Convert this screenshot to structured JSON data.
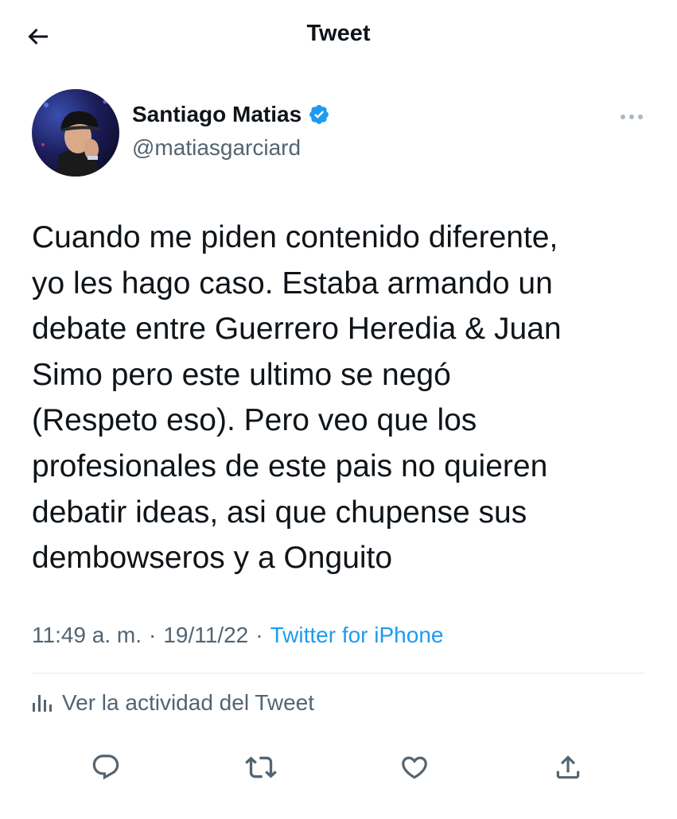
{
  "header": {
    "title": "Tweet",
    "back_icon": "arrow-left-icon"
  },
  "author": {
    "name": "Santiago Matias",
    "handle": "@matiasgarciard",
    "verified": true,
    "verified_color": "#1d9bf0"
  },
  "tweet": {
    "text": "Cuando me piden contenido diferente,\nyo les hago caso. Estaba armando un\ndebate entre Guerrero Heredia & Juan\nSimo pero este ultimo se negó\n(Respeto eso). Pero veo que los\nprofesionales de este pais no quieren\ndebatir ideas, asi que chupense sus\ndembowseros y a Onguito",
    "time": "11:49 a. m.",
    "date": "19/11/22",
    "separator": "·",
    "source": "Twitter for iPhone"
  },
  "activity": {
    "label": "Ver la actividad del Tweet",
    "icon": "bar-chart-icon"
  },
  "actions": [
    {
      "name": "reply",
      "icon": "reply-icon"
    },
    {
      "name": "retweet",
      "icon": "retweet-icon"
    },
    {
      "name": "like",
      "icon": "heart-icon"
    },
    {
      "name": "share",
      "icon": "share-icon"
    }
  ],
  "colors": {
    "text": "#0f1419",
    "secondary": "#536471",
    "accent": "#1d9bf0",
    "divider": "#e6ecf0"
  }
}
